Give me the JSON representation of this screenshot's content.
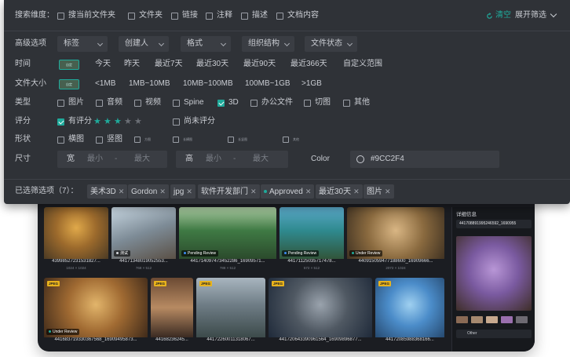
{
  "search_scope": {
    "label": "搜索维度：",
    "options": [
      {
        "label": "搜当前文件夹",
        "checked": false
      },
      {
        "label": "文件夹",
        "checked": false
      },
      {
        "label": "链接",
        "checked": false
      },
      {
        "label": "注释",
        "checked": false
      },
      {
        "label": "描述",
        "checked": false
      },
      {
        "label": "文档内容",
        "checked": false
      }
    ],
    "clear_label": "清空",
    "expand_label": "展开筛选"
  },
  "advanced": {
    "label": "高级选项",
    "dropdowns": [
      "标签",
      "创建人",
      "格式",
      "组织结构",
      "文件状态"
    ]
  },
  "time": {
    "label": "时间",
    "toggle_label": "自定",
    "options": [
      "今天",
      "昨天",
      "最近7天",
      "最近30天",
      "最近90天",
      "最近366天",
      "自定义范围"
    ]
  },
  "file_size": {
    "label": "文件大小",
    "toggle_label": "自定",
    "options": [
      "<1MB",
      "1MB~10MB",
      "10MB~100MB",
      "100MB~1GB",
      ">1GB"
    ]
  },
  "type": {
    "label": "类型",
    "options": [
      {
        "label": "图片",
        "checked": false
      },
      {
        "label": "音频",
        "checked": false
      },
      {
        "label": "视频",
        "checked": false
      },
      {
        "label": "Spine",
        "checked": false
      },
      {
        "label": "3D",
        "checked": true
      },
      {
        "label": "办公文件",
        "checked": false
      },
      {
        "label": "切图",
        "checked": false
      },
      {
        "label": "其他",
        "checked": false
      }
    ]
  },
  "rating": {
    "label": "评分",
    "has_rating_label": "有评分",
    "has_rating_checked": true,
    "stars": 3,
    "max_stars": 5,
    "unrated_label": "尚未评分"
  },
  "shape": {
    "label": "形状",
    "options": [
      {
        "label": "横图",
        "checked": false
      },
      {
        "label": "竖图",
        "checked": false
      },
      {
        "label": "方图",
        "checked": false
      },
      {
        "label": "长横图",
        "checked": false
      },
      {
        "label": "长竖图",
        "checked": false
      },
      {
        "label": "其他",
        "checked": false
      }
    ]
  },
  "size": {
    "label": "尺寸",
    "width_label": "宽",
    "height_label": "高",
    "min_placeholder": "最小",
    "max_placeholder": "最大",
    "sep": "-",
    "color_label": "Color",
    "color_value": "#9CC2F4"
  },
  "selected": {
    "label": "已选筛选项（7）：",
    "chips": [
      "美术3D",
      "Gordon",
      "jpg",
      "软件开发部门",
      "Approved",
      "最近30天",
      "图片"
    ]
  },
  "gallery": {
    "row1": [
      {
        "name": "43998527231531827...",
        "dims": "1024 × 1024",
        "status": ""
      },
      {
        "name": "44171348019052553...",
        "dims": "768 × 512",
        "status": "测试"
      },
      {
        "name": "441714097473452286_16909571...",
        "dims": "788 × 512",
        "status": "Pending Review"
      },
      {
        "name": "44171125035717478...",
        "dims": "572 × 512",
        "status": "Pending Review"
      },
      {
        "name": "440915059477188600_16909666...",
        "dims": "2072 × 1024",
        "status": "Under Review"
      }
    ],
    "row2": [
      {
        "name": "441683719330367568_16909495873...",
        "status": "Under Review",
        "format": "JPEG"
      },
      {
        "name": "44168236245...",
        "status": "",
        "format": "JPEG"
      },
      {
        "name": "44172260011318067...",
        "status": "",
        "format": "JPEG"
      },
      {
        "name": "441720643390961564_16909896877...",
        "status": "",
        "format": "JPEG"
      },
      {
        "name": "44172085988368166...",
        "status": "",
        "format": "JPEG"
      }
    ],
    "detail_title": "详细信息",
    "detail_id": "441708891995246592_1690955",
    "category_select": "Other",
    "swatch_colors": [
      "#8a6a55",
      "#a6896f",
      "#c7a98e",
      "#9a6fae",
      "#6d6a72"
    ]
  },
  "colors": {
    "accent": "#1faa9b",
    "panel_bg": "#2f3237",
    "app_bg": "#1b1d22",
    "star_on": "#1faa9b",
    "star_off": "#6b6f76"
  }
}
